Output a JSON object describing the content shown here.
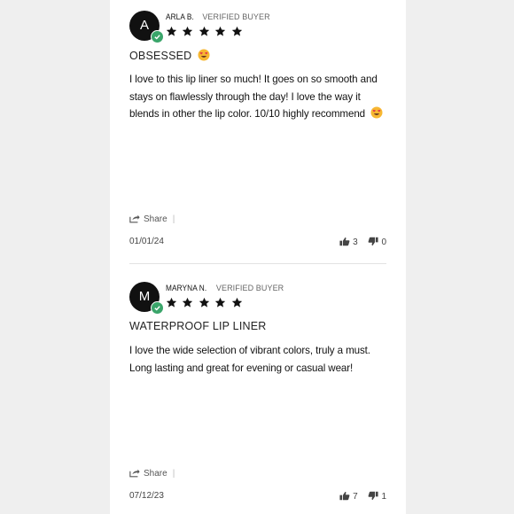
{
  "reviews": [
    {
      "avatar_letter": "A",
      "name": "ARLA B.",
      "verified": "VERIFIED BUYER",
      "rating": 5,
      "title": "OBSESSED",
      "body": "I love to this lip liner so much! It goes on so smooth and stays on flawlessly through the day! I love the way it blends in other the lip color. 10/10 highly recommend",
      "share": "Share",
      "date": "01/01/24",
      "up_votes": "3",
      "down_votes": "0"
    },
    {
      "avatar_letter": "M",
      "name": "MARYNA N.",
      "verified": "VERIFIED BUYER",
      "rating": 5,
      "title": "WATERPROOF LIP LINER",
      "body": "I love the wide selection of vibrant colors, truly a must. Long lasting and great for evening or casual wear!",
      "share": "Share",
      "date": "07/12/23",
      "up_votes": "7",
      "down_votes": "1"
    }
  ],
  "colors": {
    "badge": "#3aa56a",
    "avatar": "#111111",
    "emoji": "#f7b731"
  },
  "icons": [
    "check-icon",
    "star-icon",
    "heart-eyes-emoji-icon",
    "share-icon",
    "thumbs-up-icon",
    "thumbs-down-icon"
  ]
}
